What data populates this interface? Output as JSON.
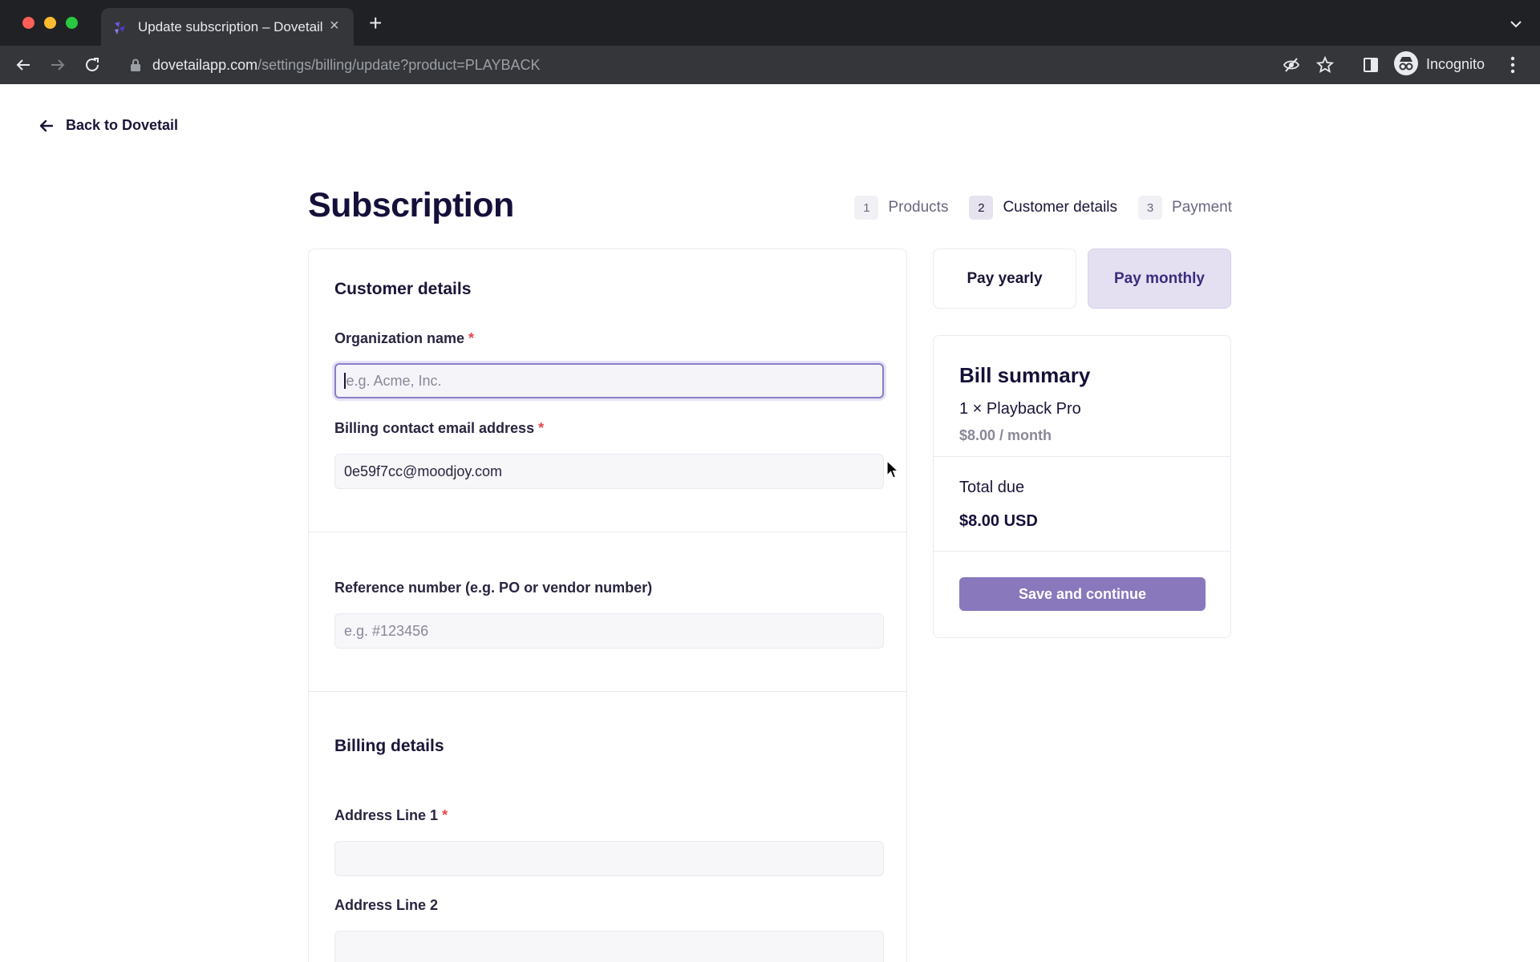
{
  "browser": {
    "tab_title": "Update subscription – Dovetail",
    "new_tab_symbol": "+",
    "close_symbol": "×",
    "url_host": "dovetailapp.com",
    "url_path": "/settings/billing/update?product=PLAYBACK",
    "profile_label": "Incognito"
  },
  "nav": {
    "back_label": "Back to Dovetail"
  },
  "page": {
    "title": "Subscription"
  },
  "steps": [
    {
      "number": "1",
      "label": "Products",
      "active": false
    },
    {
      "number": "2",
      "label": "Customer details",
      "active": true
    },
    {
      "number": "3",
      "label": "Payment",
      "active": false
    }
  ],
  "customer_details": {
    "heading": "Customer details",
    "org_name": {
      "label": "Organization name",
      "required_mark": "*",
      "value": "",
      "placeholder": "e.g. Acme, Inc."
    },
    "billing_email": {
      "label": "Billing contact email address",
      "required_mark": "*",
      "value": "0e59f7cc@moodjoy.com"
    },
    "reference": {
      "label": "Reference number (e.g. PO or vendor number)",
      "value": "",
      "placeholder": "e.g. #123456"
    }
  },
  "billing_details": {
    "heading": "Billing details",
    "address1": {
      "label": "Address Line 1",
      "required_mark": "*",
      "value": ""
    },
    "address2": {
      "label": "Address Line 2",
      "value": ""
    }
  },
  "billing_period": {
    "yearly_label": "Pay yearly",
    "monthly_label": "Pay monthly",
    "selected": "monthly"
  },
  "summary": {
    "title": "Bill summary",
    "item": "1 × Playback Pro",
    "price": "$8.00 / month",
    "total_label": "Total due",
    "total_value": "$8.00 USD",
    "cta_label": "Save and continue"
  },
  "colors": {
    "accent": "#8a78bd",
    "selected_bg": "#e4e0f1",
    "required": "#e5484d",
    "chrome_dark": "#202124",
    "chrome_toolbar": "#35363a"
  }
}
